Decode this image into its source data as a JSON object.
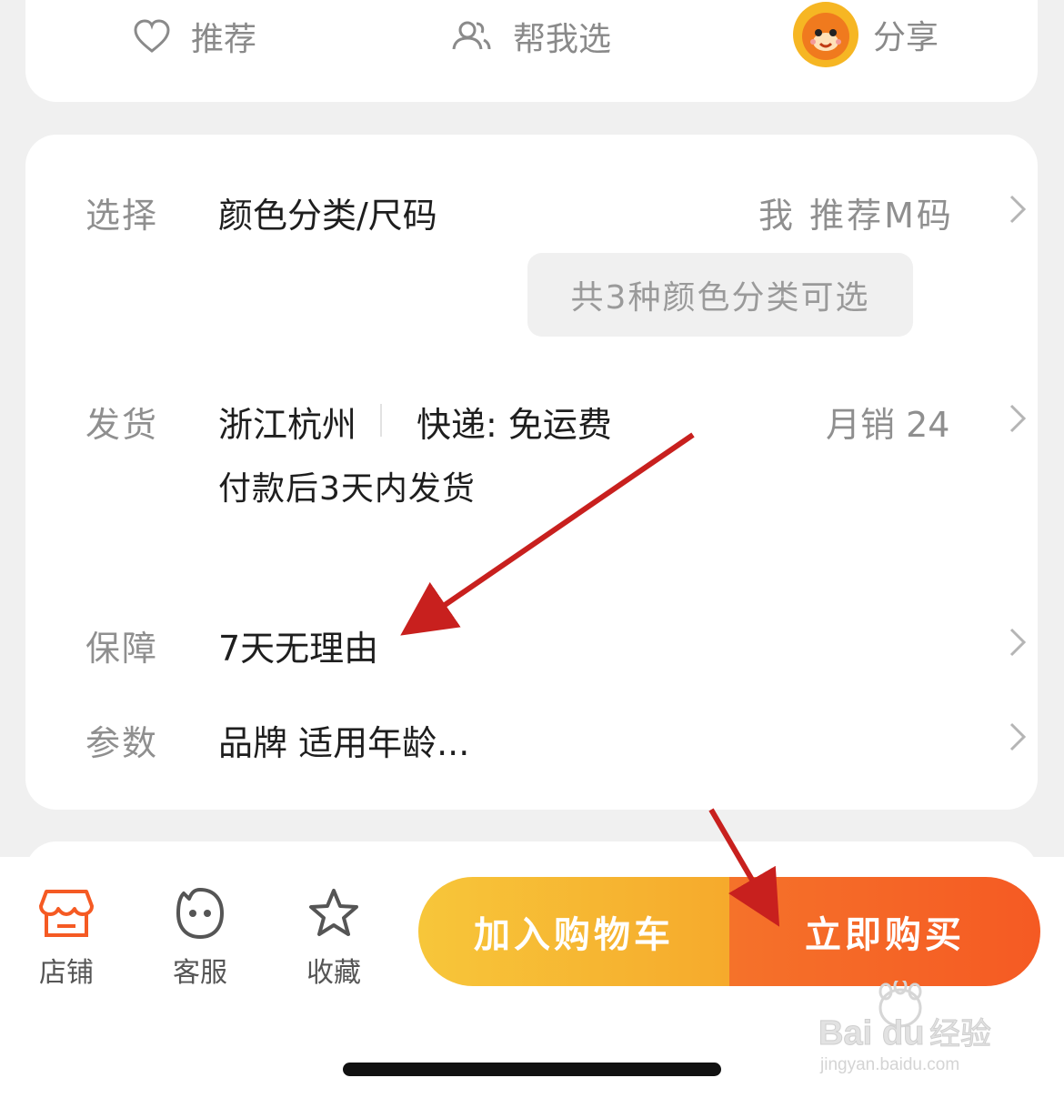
{
  "top_actions": {
    "recommend": "推荐",
    "help_choose": "帮我选",
    "share": "分享"
  },
  "rows": {
    "select": {
      "label": "选择",
      "value": "颜色分类/尺码",
      "hint": "我 推荐M码",
      "chip": "共3种颜色分类可选"
    },
    "shipping": {
      "label": "发货",
      "origin": "浙江杭州",
      "express": "快递: 免运费",
      "sales": "月销 24",
      "promise": "付款后3天内发货"
    },
    "guarantee": {
      "label": "保障",
      "value": "7天无理由"
    },
    "params": {
      "label": "参数",
      "value": "品牌 适用年龄..."
    }
  },
  "bottom_nav": {
    "store": "店铺",
    "service": "客服",
    "favorite": "收藏",
    "add_to_cart": "加入购物车",
    "buy_now": "立即购买"
  },
  "colors": {
    "accent_orange": "#f55a23",
    "accent_yellow": "#f7c63a",
    "annotation_red": "#c8201e"
  }
}
